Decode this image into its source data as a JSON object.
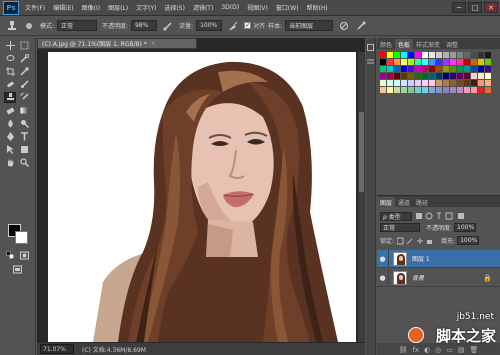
{
  "app": {
    "logo": "Ps"
  },
  "menu": [
    "文件(F)",
    "编辑(E)",
    "图像(I)",
    "图层(L)",
    "文字(Y)",
    "选择(S)",
    "滤镜(T)",
    "3D(D)",
    "视图(V)",
    "窗口(W)",
    "帮助(H)"
  ],
  "window_controls": {
    "minimize": "─",
    "maximize": "□",
    "close": "✕"
  },
  "options": {
    "mode_label": "模式:",
    "mode_value": "正常",
    "opacity_label": "不透明度:",
    "opacity_value": "98%",
    "flow_label": "流量:",
    "flow_value": "100%",
    "align_label": "对齐",
    "sample_label": "样本:",
    "sample_value": "当前图层",
    "align_checked": "✓"
  },
  "document": {
    "tab_title": "(C).A.jpg @ 71.1%(图层 1, RGB/8) *",
    "tab_close": "×",
    "zoom": "71.07%",
    "doc_info": "(C) 文档:4.36M/8.69M"
  },
  "swatches_panel": {
    "tabs": [
      "颜色",
      "色板",
      "样式渐变",
      "调整"
    ],
    "colors": [
      "#ff0000",
      "#ffff00",
      "#00ff00",
      "#00ffff",
      "#0000ff",
      "#ff00ff",
      "#ffffff",
      "#e6e6e6",
      "#cccccc",
      "#b3b3b3",
      "#999999",
      "#808080",
      "#666666",
      "#4d4d4d",
      "#333333",
      "#1a1a1a",
      "#000000",
      "#ff3333",
      "#ff9933",
      "#ffff66",
      "#99ff33",
      "#33ff99",
      "#33ffff",
      "#3399ff",
      "#3333ff",
      "#9933ff",
      "#ff33ff",
      "#ff3399",
      "#cc0000",
      "#cc6600",
      "#cccc00",
      "#66cc00",
      "#00cc66",
      "#00cccc",
      "#0066cc",
      "#0000cc",
      "#6600cc",
      "#cc00cc",
      "#cc0066",
      "#990000",
      "#994c00",
      "#999900",
      "#4c9900",
      "#00994c",
      "#009999",
      "#004c99",
      "#000099",
      "#4c0099",
      "#990099",
      "#99004c",
      "#660000",
      "#663300",
      "#666600",
      "#336600",
      "#006633",
      "#006666",
      "#003366",
      "#000066",
      "#330066",
      "#660066",
      "#660033",
      "#ffcccc",
      "#ffe5cc",
      "#ffffcc",
      "#e5ffcc",
      "#ccffe5",
      "#ccffff",
      "#cce5ff",
      "#ccccff",
      "#e5ccff",
      "#ffccff",
      "#ffcce5",
      "#c69c6d",
      "#a67c52",
      "#8c6239",
      "#754c24",
      "#603913",
      "#42210b",
      "#f7977a",
      "#fbad82",
      "#fdc68c",
      "#fff799",
      "#c4df9b",
      "#a3d39c",
      "#82ca9c",
      "#7bcdc8",
      "#6ecff6",
      "#7ea7d8",
      "#8493ca",
      "#8882be",
      "#a187be",
      "#bc8dbf",
      "#f49ac2",
      "#f6989d",
      "#ed1c24",
      "#f26522"
    ]
  },
  "layers_panel": {
    "tabs": [
      "图层",
      "通道",
      "路径"
    ],
    "kind_label": "ρ 类型",
    "blend_mode": "正常",
    "opacity_label": "不透明度:",
    "opacity_value": "100%",
    "lock_label": "锁定:",
    "fill_label": "填充:",
    "fill_value": "100%",
    "layers": [
      {
        "name": "图层 1",
        "selected": true
      },
      {
        "name": "背景",
        "selected": false
      }
    ],
    "eye": "●",
    "lock_icon": "🔒",
    "bottom_icons": [
      "⛓",
      "fx",
      "◐",
      "◎",
      "▭",
      "▤",
      "🗑"
    ]
  },
  "watermark": {
    "url": "jb51.net",
    "site": "脚本之家"
  }
}
